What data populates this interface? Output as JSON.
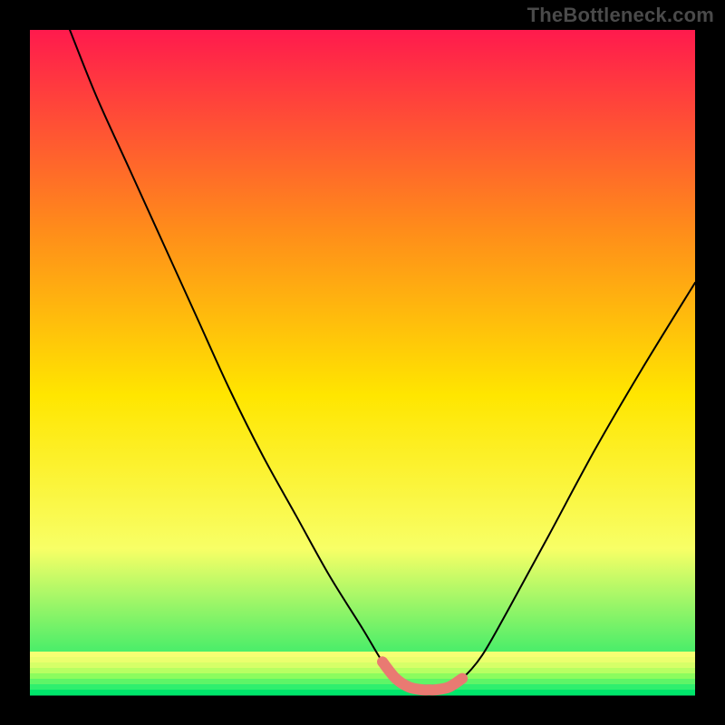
{
  "watermark": "TheBottleneck.com",
  "chart_data": {
    "type": "line",
    "title": "",
    "xlabel": "",
    "ylabel": "",
    "xlim": [
      0,
      100
    ],
    "ylim": [
      0,
      100
    ],
    "background_gradient": {
      "top": "#ff1a4d",
      "mid_upper": "#ff8c1a",
      "mid": "#ffe600",
      "lower": "#f8ff66",
      "bottom": "#00e66b"
    },
    "series": [
      {
        "name": "main-curve",
        "color": "#000000",
        "x": [
          6,
          10,
          15,
          20,
          25,
          30,
          35,
          40,
          45,
          50,
          53,
          55,
          57,
          59,
          61,
          63,
          65,
          68,
          72,
          78,
          85,
          92,
          100
        ],
        "y": [
          100,
          90,
          79,
          68,
          57,
          46,
          36,
          27,
          18,
          10,
          5,
          2.5,
          1.2,
          0.8,
          0.8,
          1.2,
          2.5,
          6,
          13,
          24,
          37,
          49,
          62
        ]
      },
      {
        "name": "highlight-bottom",
        "color": "#e97a72",
        "x": [
          53,
          55,
          57,
          59,
          60,
          61,
          63,
          65
        ],
        "y": [
          5,
          2.5,
          1.2,
          0.8,
          0.8,
          0.8,
          1.2,
          2.5
        ]
      }
    ],
    "bottom_stripes": [
      "#f6ff73",
      "#eaff6e",
      "#d6ff68",
      "#b8ff62",
      "#8cfc5e",
      "#5ef567",
      "#2fef6e",
      "#00e66b"
    ]
  }
}
